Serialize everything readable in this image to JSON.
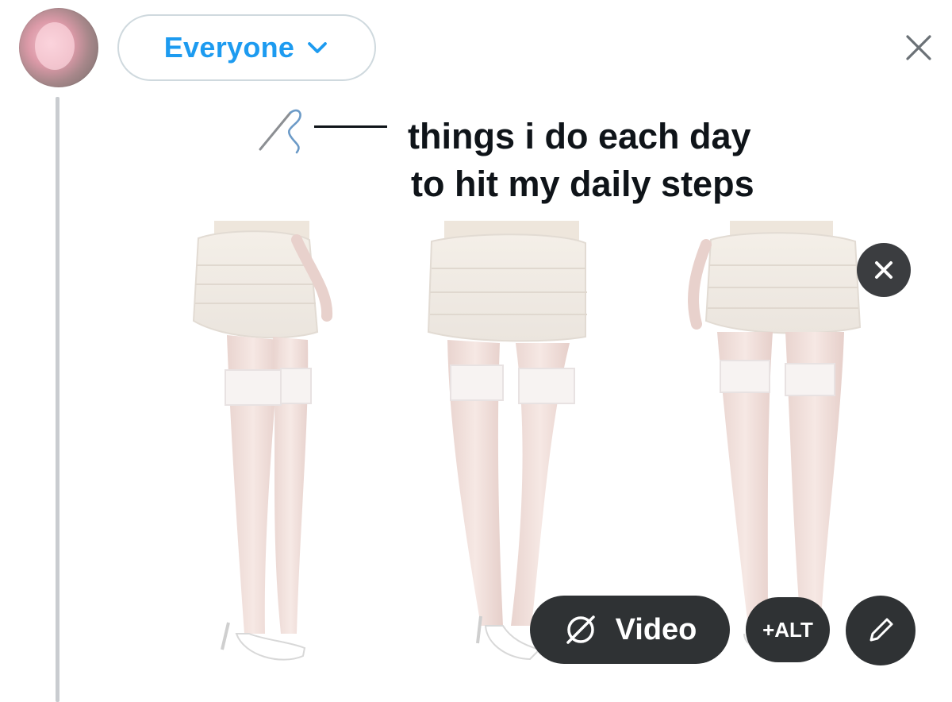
{
  "composer": {
    "audience": {
      "label": "Everyone",
      "icon": "chevron-down-icon"
    },
    "close_icon": "close-icon",
    "avatar_icon": "avatar"
  },
  "media": {
    "caption_line1": "things i do each day",
    "caption_line2": "to hit my daily steps",
    "photo_description": "three lower-body product shots of legs in white lace-top thigh-high stockings and white ruffled lace mini skirt",
    "actions": {
      "remove_icon": "close-icon",
      "video_label": "Video",
      "video_icon": "no-video-icon",
      "alt_label": "+ALT",
      "edit_icon": "pencil-icon"
    }
  },
  "colors": {
    "accent": "#1d9bf0",
    "pill_bg": "#2f3234",
    "thread_line": "#c9ccd0"
  }
}
